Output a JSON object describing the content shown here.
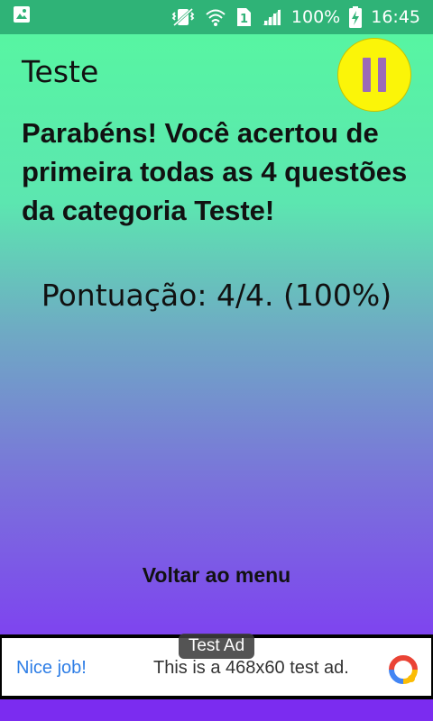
{
  "status_bar": {
    "battery": "100%",
    "time": "16:45",
    "sim_slot": "1",
    "bg_color": "#2fb377",
    "icons": [
      "image-icon",
      "vibrate-icon",
      "wifi-icon",
      "sim-icon",
      "signal-icon",
      "battery-charging-icon"
    ]
  },
  "header": {
    "category": "Teste",
    "pause_icon": "pause-icon",
    "pause_color": "#fbf508"
  },
  "result": {
    "message": "Parabéns! Você acertou de primeira todas as 4 questões da categoria Teste!",
    "score": "Pontuação: 4/4. (100%)"
  },
  "actions": {
    "back_to_menu": "Voltar ao menu"
  },
  "ad": {
    "label": "Test Ad",
    "headline": "Nice job!",
    "body": "This is a 468x60 test ad.",
    "logo_icon": "ad-choices-icon"
  },
  "colors": {
    "gradient_top": "#57f5a2",
    "gradient_bottom": "#7e44ef"
  }
}
